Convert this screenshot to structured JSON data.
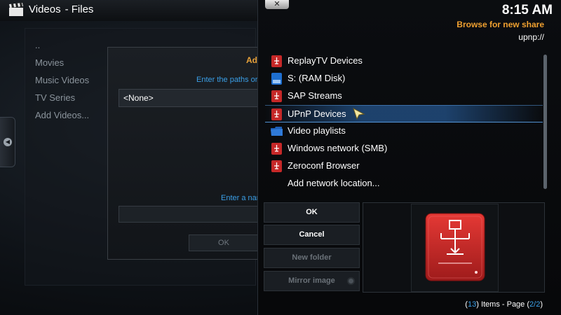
{
  "window": {
    "title": "Videos",
    "section": "- Files",
    "clock": "8:15 AM"
  },
  "left_menu": {
    "items": [
      {
        "label": ".."
      },
      {
        "label": "Movies"
      },
      {
        "label": "Music Videos"
      },
      {
        "label": "TV Series"
      },
      {
        "label": "Add Videos..."
      }
    ]
  },
  "add_source_dialog": {
    "title_partial": "Ad",
    "paths_prompt_partial": "Enter the paths or",
    "path_value": "<None>",
    "name_prompt_partial": "Enter a nar",
    "ok_label": "OK"
  },
  "browse_dialog": {
    "close_label": "✕",
    "heading": "Browse for new share",
    "path": "upnp://",
    "items": [
      {
        "label": "ReplayTV Devices",
        "icon": "network-drive-icon"
      },
      {
        "label": "S: (RAM Disk)",
        "icon": "blue-drive-icon"
      },
      {
        "label": "SAP Streams",
        "icon": "network-drive-icon"
      },
      {
        "label": "UPnP Devices",
        "icon": "network-drive-icon",
        "focused": true
      },
      {
        "label": "Video playlists",
        "icon": "folder-icon"
      },
      {
        "label": "Windows network (SMB)",
        "icon": "network-drive-icon"
      },
      {
        "label": "Zeroconf Browser",
        "icon": "network-drive-icon"
      },
      {
        "label": "Add network location...",
        "icon": ""
      }
    ],
    "buttons": {
      "ok": "OK",
      "cancel": "Cancel",
      "new_folder": "New folder",
      "mirror_image": "Mirror image"
    },
    "footer": {
      "count": "13",
      "items_text": "Items - Page",
      "page": "2/2"
    }
  },
  "colors": {
    "accent_orange": "#f0a030",
    "accent_blue": "#3a9ee6",
    "drive_red": "#c62828"
  }
}
